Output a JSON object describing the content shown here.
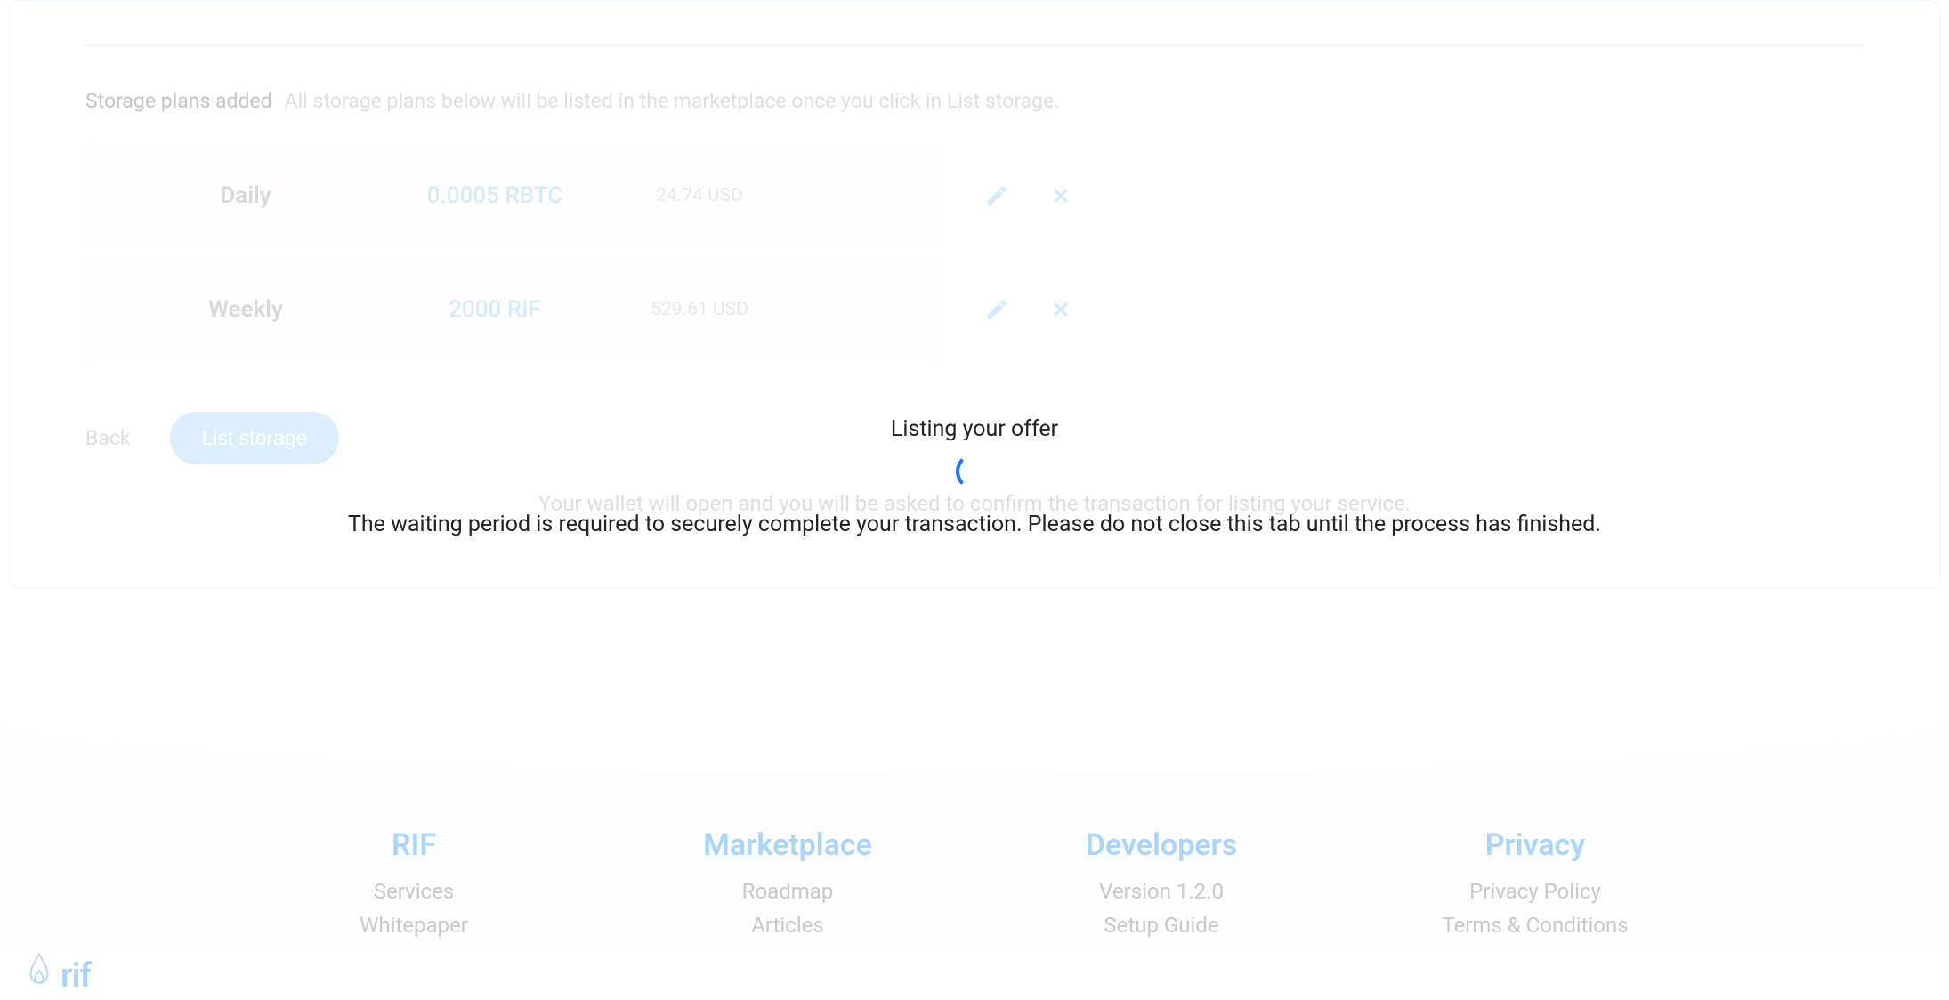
{
  "plans": {
    "headerTitle": "Storage plans added",
    "headerDesc": "All storage plans below will be listed in the marketplace once you click in List storage.",
    "rows": [
      {
        "period": "Daily",
        "price": "0.0005 RBTC",
        "usd": "24.74 USD"
      },
      {
        "period": "Weekly",
        "price": "2000 RIF",
        "usd": "529.61 USD"
      }
    ]
  },
  "actions": {
    "back": "Back",
    "listStorage": "List storage",
    "info": "Your wallet will open and you will be asked to confirm the transaction for listing your service."
  },
  "loading": {
    "title": "Listing your offer",
    "desc": "The waiting period is required to securely complete your transaction. Please do not close this tab until the process has finished."
  },
  "footer": {
    "logo": "rif",
    "cols": [
      {
        "title": "RIF",
        "links": [
          "Services",
          "Whitepaper"
        ]
      },
      {
        "title": "Marketplace",
        "links": [
          "Roadmap",
          "Articles"
        ]
      },
      {
        "title": "Developers",
        "links": [
          "Version 1.2.0",
          "Setup Guide"
        ]
      },
      {
        "title": "Privacy",
        "links": [
          "Privacy Policy",
          "Terms & Conditions"
        ]
      }
    ]
  }
}
